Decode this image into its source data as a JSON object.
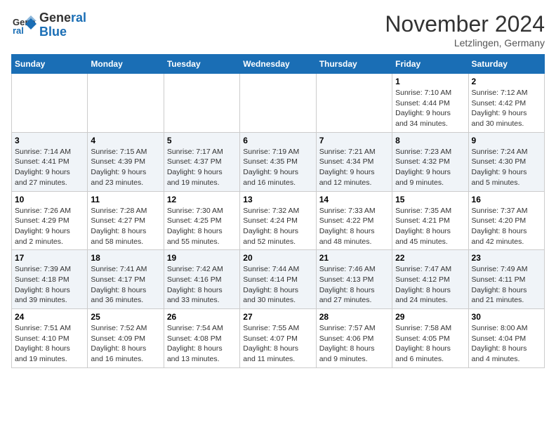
{
  "header": {
    "logo_line1": "General",
    "logo_line2": "Blue",
    "month_title": "November 2024",
    "location": "Letzlingen, Germany"
  },
  "weekdays": [
    "Sunday",
    "Monday",
    "Tuesday",
    "Wednesday",
    "Thursday",
    "Friday",
    "Saturday"
  ],
  "weeks": [
    [
      {
        "day": "",
        "info": ""
      },
      {
        "day": "",
        "info": ""
      },
      {
        "day": "",
        "info": ""
      },
      {
        "day": "",
        "info": ""
      },
      {
        "day": "",
        "info": ""
      },
      {
        "day": "1",
        "info": "Sunrise: 7:10 AM\nSunset: 4:44 PM\nDaylight: 9 hours\nand 34 minutes."
      },
      {
        "day": "2",
        "info": "Sunrise: 7:12 AM\nSunset: 4:42 PM\nDaylight: 9 hours\nand 30 minutes."
      }
    ],
    [
      {
        "day": "3",
        "info": "Sunrise: 7:14 AM\nSunset: 4:41 PM\nDaylight: 9 hours\nand 27 minutes."
      },
      {
        "day": "4",
        "info": "Sunrise: 7:15 AM\nSunset: 4:39 PM\nDaylight: 9 hours\nand 23 minutes."
      },
      {
        "day": "5",
        "info": "Sunrise: 7:17 AM\nSunset: 4:37 PM\nDaylight: 9 hours\nand 19 minutes."
      },
      {
        "day": "6",
        "info": "Sunrise: 7:19 AM\nSunset: 4:35 PM\nDaylight: 9 hours\nand 16 minutes."
      },
      {
        "day": "7",
        "info": "Sunrise: 7:21 AM\nSunset: 4:34 PM\nDaylight: 9 hours\nand 12 minutes."
      },
      {
        "day": "8",
        "info": "Sunrise: 7:23 AM\nSunset: 4:32 PM\nDaylight: 9 hours\nand 9 minutes."
      },
      {
        "day": "9",
        "info": "Sunrise: 7:24 AM\nSunset: 4:30 PM\nDaylight: 9 hours\nand 5 minutes."
      }
    ],
    [
      {
        "day": "10",
        "info": "Sunrise: 7:26 AM\nSunset: 4:29 PM\nDaylight: 9 hours\nand 2 minutes."
      },
      {
        "day": "11",
        "info": "Sunrise: 7:28 AM\nSunset: 4:27 PM\nDaylight: 8 hours\nand 58 minutes."
      },
      {
        "day": "12",
        "info": "Sunrise: 7:30 AM\nSunset: 4:25 PM\nDaylight: 8 hours\nand 55 minutes."
      },
      {
        "day": "13",
        "info": "Sunrise: 7:32 AM\nSunset: 4:24 PM\nDaylight: 8 hours\nand 52 minutes."
      },
      {
        "day": "14",
        "info": "Sunrise: 7:33 AM\nSunset: 4:22 PM\nDaylight: 8 hours\nand 48 minutes."
      },
      {
        "day": "15",
        "info": "Sunrise: 7:35 AM\nSunset: 4:21 PM\nDaylight: 8 hours\nand 45 minutes."
      },
      {
        "day": "16",
        "info": "Sunrise: 7:37 AM\nSunset: 4:20 PM\nDaylight: 8 hours\nand 42 minutes."
      }
    ],
    [
      {
        "day": "17",
        "info": "Sunrise: 7:39 AM\nSunset: 4:18 PM\nDaylight: 8 hours\nand 39 minutes."
      },
      {
        "day": "18",
        "info": "Sunrise: 7:41 AM\nSunset: 4:17 PM\nDaylight: 8 hours\nand 36 minutes."
      },
      {
        "day": "19",
        "info": "Sunrise: 7:42 AM\nSunset: 4:16 PM\nDaylight: 8 hours\nand 33 minutes."
      },
      {
        "day": "20",
        "info": "Sunrise: 7:44 AM\nSunset: 4:14 PM\nDaylight: 8 hours\nand 30 minutes."
      },
      {
        "day": "21",
        "info": "Sunrise: 7:46 AM\nSunset: 4:13 PM\nDaylight: 8 hours\nand 27 minutes."
      },
      {
        "day": "22",
        "info": "Sunrise: 7:47 AM\nSunset: 4:12 PM\nDaylight: 8 hours\nand 24 minutes."
      },
      {
        "day": "23",
        "info": "Sunrise: 7:49 AM\nSunset: 4:11 PM\nDaylight: 8 hours\nand 21 minutes."
      }
    ],
    [
      {
        "day": "24",
        "info": "Sunrise: 7:51 AM\nSunset: 4:10 PM\nDaylight: 8 hours\nand 19 minutes."
      },
      {
        "day": "25",
        "info": "Sunrise: 7:52 AM\nSunset: 4:09 PM\nDaylight: 8 hours\nand 16 minutes."
      },
      {
        "day": "26",
        "info": "Sunrise: 7:54 AM\nSunset: 4:08 PM\nDaylight: 8 hours\nand 13 minutes."
      },
      {
        "day": "27",
        "info": "Sunrise: 7:55 AM\nSunset: 4:07 PM\nDaylight: 8 hours\nand 11 minutes."
      },
      {
        "day": "28",
        "info": "Sunrise: 7:57 AM\nSunset: 4:06 PM\nDaylight: 8 hours\nand 9 minutes."
      },
      {
        "day": "29",
        "info": "Sunrise: 7:58 AM\nSunset: 4:05 PM\nDaylight: 8 hours\nand 6 minutes."
      },
      {
        "day": "30",
        "info": "Sunrise: 8:00 AM\nSunset: 4:04 PM\nDaylight: 8 hours\nand 4 minutes."
      }
    ]
  ]
}
